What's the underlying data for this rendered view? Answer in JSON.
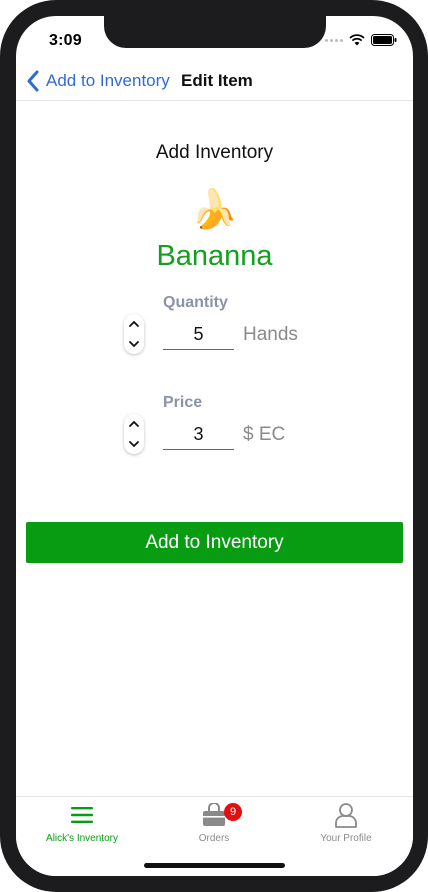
{
  "status_bar": {
    "time": "3:09"
  },
  "nav": {
    "back_label": "Add to Inventory",
    "title": "Edit Item"
  },
  "main": {
    "section_title": "Add Inventory",
    "product_emoji": "🍌",
    "product_name": "Bananna",
    "quantity": {
      "label": "Quantity",
      "value": "5",
      "unit": "Hands"
    },
    "price": {
      "label": "Price",
      "value": "3",
      "unit": "$ EC"
    },
    "submit_label": "Add to Inventory"
  },
  "tab_bar": {
    "tabs": [
      {
        "label": "Alick's Inventory",
        "icon": "menu-icon",
        "active": true
      },
      {
        "label": "Orders",
        "icon": "shopping-bag-icon",
        "badge": "9",
        "active": false
      },
      {
        "label": "Your Profile",
        "icon": "person-icon",
        "active": false
      }
    ]
  },
  "colors": {
    "accent_green": "#089c12",
    "product_green": "#14a01f",
    "link_blue": "#2f6bd8",
    "badge_red": "#e01010",
    "label_gray": "#8a94a6"
  }
}
